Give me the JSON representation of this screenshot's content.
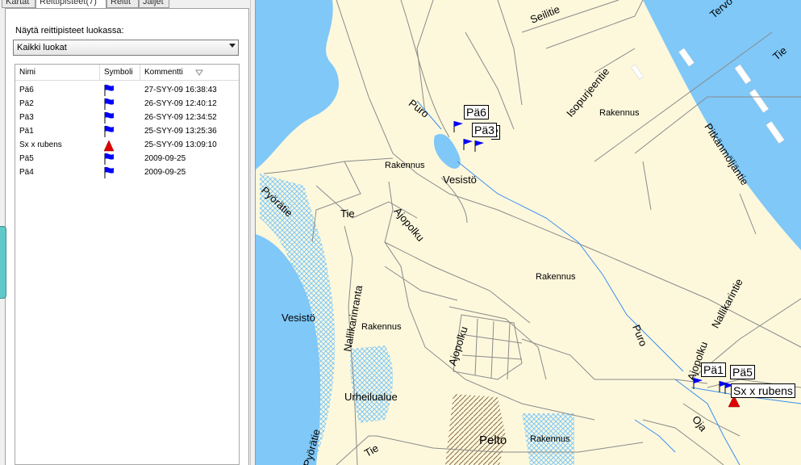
{
  "tabs": [
    {
      "label": "Kartat",
      "active": false
    },
    {
      "label": "Reittipisteet(7)",
      "active": true
    },
    {
      "label": "Reitit",
      "active": false
    },
    {
      "label": "Jäljet",
      "active": false
    }
  ],
  "filter": {
    "label": "Näytä reittipisteet luokassa:",
    "selected": "Kaikki luokat"
  },
  "columns": {
    "name": "Nimi",
    "symbol": "Symboli",
    "comment": "Kommentti"
  },
  "waypoints": [
    {
      "name": "Pä6",
      "symbol": "blue-flag-icon",
      "comment": "27-SYY-09 16:38:43"
    },
    {
      "name": "Pä2",
      "symbol": "blue-flag-icon",
      "comment": "26-SYY-09 12:40:12"
    },
    {
      "name": "Pä3",
      "symbol": "blue-flag-icon",
      "comment": "26-SYY-09 12:34:52"
    },
    {
      "name": "Pä1",
      "symbol": "blue-flag-icon",
      "comment": "25-SYY-09 13:25:36"
    },
    {
      "name": "Sx x rubens",
      "symbol": "red-triangle-icon",
      "comment": "25-SYY-09 13:09:10"
    },
    {
      "name": "Pä5",
      "symbol": "blue-flag-icon",
      "comment": "2009-09-25"
    },
    {
      "name": "Pä4",
      "symbol": "blue-flag-icon",
      "comment": "2009-09-25"
    }
  ],
  "map_labels": {
    "seilitie": "Seilitie",
    "tervontie": "Tervo",
    "tie_top": "Tie",
    "isopurjeentie": "Isopurjeentie",
    "rakennus_1": "Rakennus",
    "pitkanmoljantie": "Pitkänmöljäntie",
    "puro_1": "Puro",
    "rakennus_2": "Rakennus",
    "vesisto_1": "Vesistö",
    "pyoratie_1": "Pyörätie",
    "tie_1": "Tie",
    "ajopolku_1": "Ajopolku",
    "rakennus_3": "Rakennus",
    "nallikarintie": "Nallikarintie",
    "vesisto_2": "Vesistö",
    "nallikarinranta": "Nallikarinranta",
    "rakennus_4": "Rakennus",
    "ajopolku_2": "Ajopolku",
    "puro_2": "Puro",
    "ajopolku_3": "Ajopolku",
    "urheilualue": "Urheilualue",
    "oja": "Oja",
    "pyoratie_2": "Pyörätie",
    "tie_2": "Tie",
    "pelto": "Pelto",
    "rakennus_5": "Rakennus"
  },
  "map_waypoints": {
    "pa6": "Pä6",
    "pa3": "Pä3",
    "pa2_partial": "2",
    "pa1": "Pä1",
    "pa5": "Pä5",
    "sx": "Sx x rubens"
  },
  "colors": {
    "land": "#fdf8dc",
    "water": "#7fc8f8",
    "road": "#8a8a8a",
    "flag": "#0000ff",
    "triangle": "#e00000"
  }
}
